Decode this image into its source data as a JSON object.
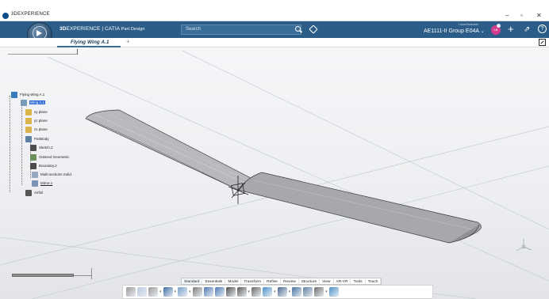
{
  "window": {
    "title": "3DEXPERIENCE",
    "controls": [
      "–",
      "▫",
      "✕"
    ]
  },
  "header": {
    "brand_mark": "3S",
    "compass_version": "V.R",
    "app_title_bold": "3D",
    "app_title_rest": "EXPERIENCE | CATIA",
    "app_title_role": "Part Design",
    "search_placeholder": "Search",
    "user_name": "Lucas Beaudoin",
    "collab_space": "AE1111-II Group E04A",
    "avatar_initials": "LB",
    "icons": {
      "search": "search-icon",
      "tag": "tag-icon",
      "add": "plus-icon",
      "share": "share-icon",
      "help": "help-icon"
    }
  },
  "tabs": {
    "active": "Flying Wing A.1",
    "add": "+"
  },
  "tree": [
    {
      "label": "Flying Wing A.1",
      "icon": "product-icon",
      "color": "#3a7bbf"
    },
    {
      "label": "Wing A.1",
      "icon": "part-icon",
      "color": "#7a9ab8",
      "selected": true
    },
    {
      "label": "xy plane",
      "icon": "plane-icon",
      "color": "#d9b44a"
    },
    {
      "label": "yz plane",
      "icon": "plane-icon",
      "color": "#d9b44a"
    },
    {
      "label": "zx plane",
      "icon": "plane-icon",
      "color": "#d9b44a"
    },
    {
      "label": "PartBody",
      "icon": "body-icon",
      "color": "#5e7fa0"
    },
    {
      "label": "Sketch.2",
      "icon": "sketch-icon",
      "color": "#4d4d4d"
    },
    {
      "label": "Ordered Geometric",
      "icon": "geoset-icon",
      "color": "#6c8f5a"
    },
    {
      "label": "Boundary.2",
      "icon": "boundary-icon",
      "color": "#4a4a4a"
    },
    {
      "label": "Multi-sections Solid.",
      "icon": "loft-icon",
      "color": "#9aa9c2"
    },
    {
      "label": "Mirror.1",
      "icon": "mirror-icon",
      "color": "#7d93b5",
      "underline": true
    },
    {
      "label": "Airfoil",
      "icon": "geoset-icon",
      "color": "#555555"
    }
  ],
  "section_tabs": [
    "Standard",
    "Essentials",
    "Model",
    "Transform",
    "Refine",
    "Review",
    "Structure",
    "View",
    "AR-VR",
    "Tools",
    "Touch"
  ],
  "active_section": "Standard",
  "toolbar_icons": [
    {
      "name": "cut-icon",
      "color": "#9a9a9a"
    },
    {
      "name": "copy-icon",
      "color": "#b9c9dd"
    },
    {
      "name": "paste-icon",
      "color": "#9a9a9a"
    },
    {
      "name": "undo-icon",
      "color": "#3b6ea5"
    },
    {
      "name": "update-icon",
      "color": "#7aa0c8"
    },
    {
      "name": "fly-icon",
      "color": "#7d7d7d"
    },
    {
      "name": "pan-icon",
      "color": "#4b79b5"
    },
    {
      "name": "rotate-icon",
      "color": "#4b79b5"
    },
    {
      "name": "zoom-icon",
      "color": "#4d4d4d"
    },
    {
      "name": "fit-all-icon",
      "color": "#5a5a5a"
    },
    {
      "name": "normal-view-icon",
      "color": "#6a6a6a"
    },
    {
      "name": "iso-view-icon",
      "color": "#4a8fc9"
    },
    {
      "name": "render-style-icon",
      "color": "#4c6b8f"
    },
    {
      "name": "hide-show-icon",
      "color": "#44719e"
    },
    {
      "name": "swap-icon",
      "color": "#5f7ea0"
    },
    {
      "name": "settings-icon",
      "color": "#6d6d6d"
    },
    {
      "name": "capture-icon",
      "color": "#4a8fc9"
    }
  ]
}
